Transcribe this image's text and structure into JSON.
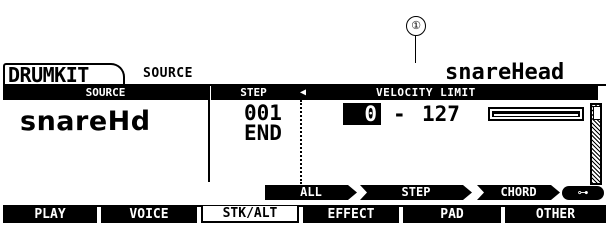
{
  "callout": {
    "number": "①"
  },
  "header": {
    "tab_drumkit": "DRUMKIT",
    "tab_source": "SOURCE",
    "title": "snareHead"
  },
  "columns": {
    "source": "SOURCE",
    "step": "STEP",
    "velocity_limit": "VELOCITY LIMIT",
    "left_arrow": "◀"
  },
  "values": {
    "source": "snareHd",
    "step_current": "001",
    "step_end": "END",
    "velocity_min": "0",
    "velocity_dash": "-",
    "velocity_max": "127"
  },
  "velocity_bar": {
    "min": 0,
    "max": 127
  },
  "function_buttons": {
    "all": "ALL",
    "step": "STEP",
    "chord": "CHORD",
    "key": "⊶"
  },
  "tabs": [
    {
      "label": "PLAY",
      "active": false
    },
    {
      "label": "VOICE",
      "active": false
    },
    {
      "label": "STK/ALT",
      "active": true
    },
    {
      "label": "EFFECT",
      "active": false
    },
    {
      "label": "PAD",
      "active": false
    },
    {
      "label": "OTHER",
      "active": false
    }
  ]
}
